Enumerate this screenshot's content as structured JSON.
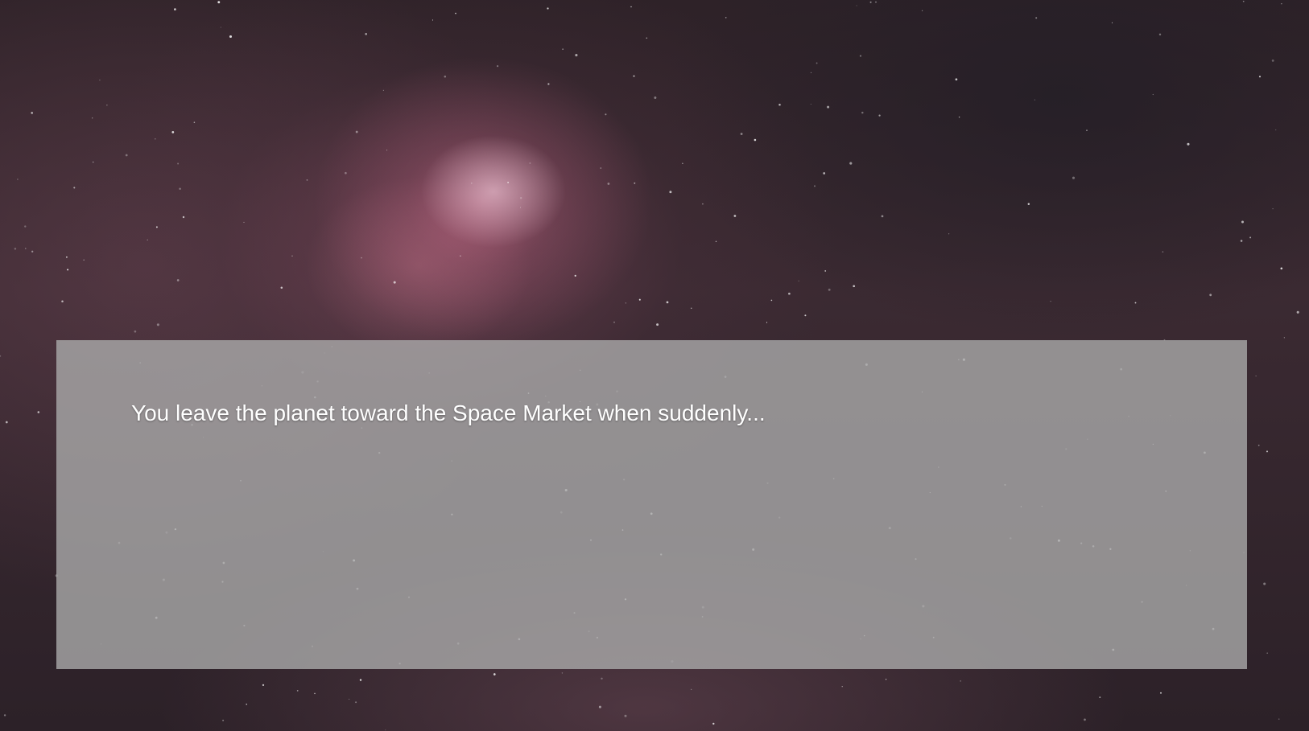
{
  "dialog": {
    "text": "You leave the planet toward the Space Market when suddenly..."
  },
  "colors": {
    "nebula": "#c86e8c",
    "space": "#2e2228",
    "dialog_panel": "#aaaaaa",
    "dialog_text": "#ffffff"
  }
}
